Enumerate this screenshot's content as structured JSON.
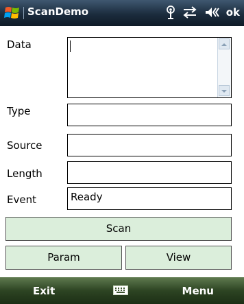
{
  "titlebar": {
    "app_title": "ScanDemo",
    "ok_label": "ok",
    "icons": [
      "windows-start-icon",
      "antenna-icon",
      "connectivity-icon",
      "volume-icon"
    ]
  },
  "form": {
    "data_label": "Data",
    "data_value": "",
    "type_label": "Type",
    "type_value": "",
    "source_label": "Source",
    "source_value": "",
    "length_label": "Length",
    "length_value": "",
    "event_label": "Event",
    "event_value": "Ready"
  },
  "buttons": {
    "scan": "Scan",
    "param": "Param",
    "view": "View"
  },
  "softkeys": {
    "left": "Exit",
    "right": "Menu",
    "center_icon": "keyboard-icon"
  },
  "colors": {
    "button_bg": "#dbeedb",
    "titlebar": "#1b2c3d",
    "softbar": "#2d4423"
  }
}
